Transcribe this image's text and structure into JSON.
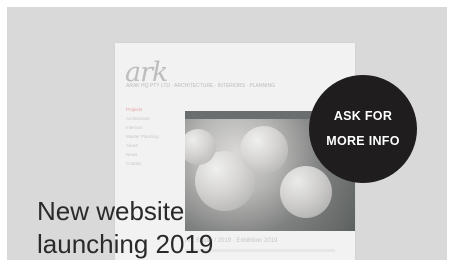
{
  "mockup": {
    "logo": "ark",
    "tagline": "ARAK HQ PTY LTD · ARCHITECTURE · INTERIORS · PLANNING",
    "nav": [
      "Projects",
      "Architecture",
      "Interiors",
      "Master Planning",
      "About",
      "News",
      "Contact"
    ],
    "caption": "Ark Studio / 2019 · Exhibition 2019"
  },
  "headline": {
    "line1": "New website",
    "line2": "launching 2019"
  },
  "badge": {
    "line1": "ASK FOR",
    "line2": "MORE INFO"
  }
}
